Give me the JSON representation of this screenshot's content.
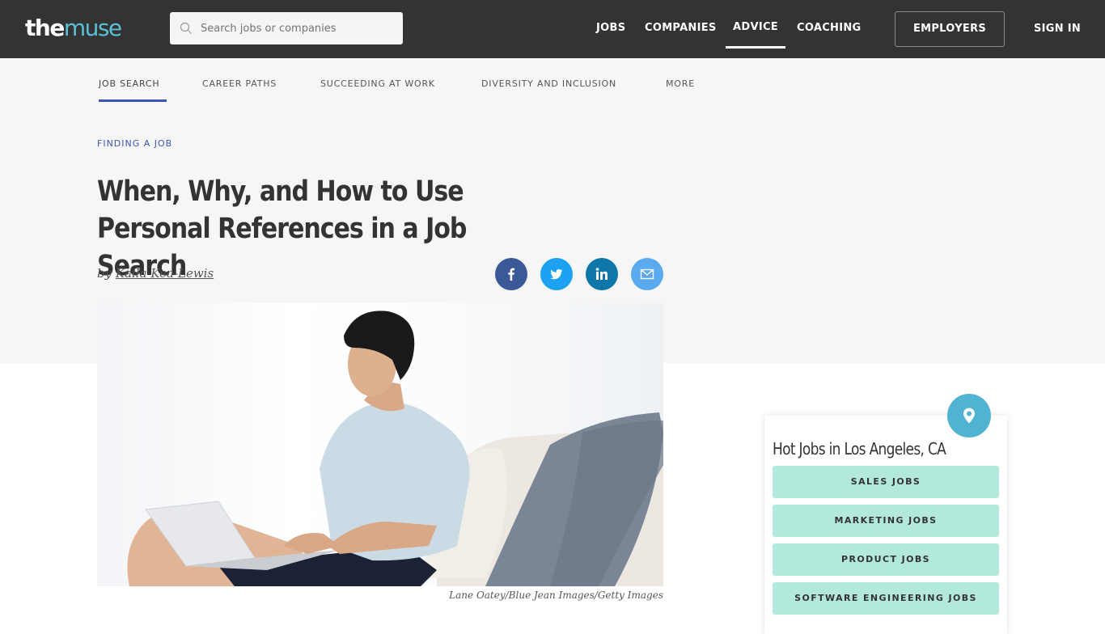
{
  "header": {
    "logo": {
      "the": "the",
      "muse": "muse"
    },
    "search": {
      "placeholder": "Search jobs or companies",
      "value": ""
    },
    "nav": [
      {
        "label": "JOBS",
        "active": false
      },
      {
        "label": "COMPANIES",
        "active": false
      },
      {
        "label": "ADVICE",
        "active": true
      },
      {
        "label": "COACHING",
        "active": false
      }
    ],
    "employers_label": "EMPLOYERS",
    "signin_label": "SIGN IN"
  },
  "subnav": {
    "items": [
      {
        "label": "JOB SEARCH",
        "active": true
      },
      {
        "label": "CAREER PATHS",
        "active": false
      },
      {
        "label": "SUCCEEDING AT WORK",
        "active": false
      },
      {
        "label": "DIVERSITY AND INCLUSION",
        "active": false
      },
      {
        "label": "MORE",
        "active": false
      }
    ]
  },
  "article": {
    "category": "FINDING A JOB",
    "title": "When, Why, and How to Use Personal References in a Job Search",
    "byline_prefix": "by",
    "author": "Kaila Kea-Lewis",
    "share": [
      {
        "network": "facebook",
        "icon": "facebook-icon",
        "color": "#3b5998"
      },
      {
        "network": "twitter",
        "icon": "twitter-icon",
        "color": "#1da1f2"
      },
      {
        "network": "linkedin",
        "icon": "linkedin-icon",
        "color": "#0e76a8"
      },
      {
        "network": "email",
        "icon": "mail-icon",
        "color": "#5aaaf0"
      }
    ],
    "image_alt": "Man smiling while typing on a laptop on a couch",
    "image_caption": "Lane Oatey/Blue Jean Images/Getty Images"
  },
  "widget": {
    "title": "Hot Jobs in Los Angeles, CA",
    "icon": "location-pin-icon",
    "buttons": [
      {
        "label": "SALES JOBS"
      },
      {
        "label": "MARKETING JOBS"
      },
      {
        "label": "PRODUCT JOBS"
      },
      {
        "label": "SOFTWARE ENGINEERING JOBS"
      }
    ]
  },
  "colors": {
    "topbar": "#333333",
    "brand_accent": "#5cc0d6",
    "link_blue": "#3c55b4",
    "widget_button": "#b3e9dc",
    "pin": "#4fb3d1"
  }
}
